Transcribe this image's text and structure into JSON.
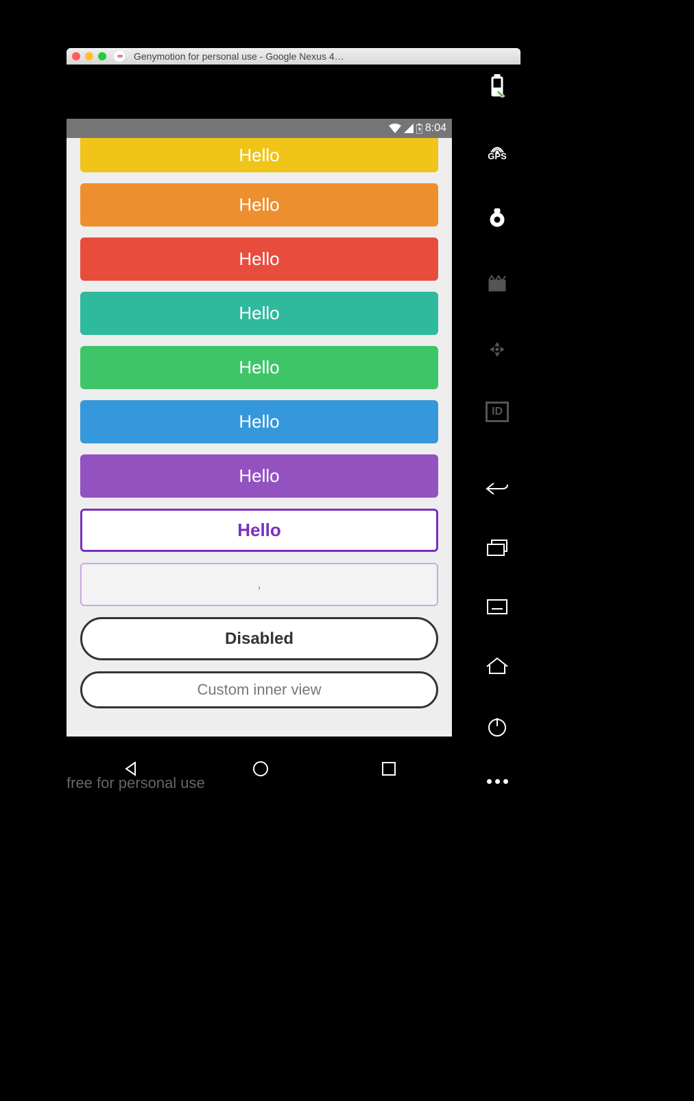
{
  "window": {
    "title": "Genymotion for personal use - Google Nexus 4…"
  },
  "statusbar": {
    "time": "8:04"
  },
  "buttons": [
    {
      "label": "Hello",
      "color": "#F0C419"
    },
    {
      "label": "Hello",
      "color": "#EE8F2F"
    },
    {
      "label": "Hello",
      "color": "#E84C3D"
    },
    {
      "label": "Hello",
      "color": "#2FBA9E"
    },
    {
      "label": "Hello",
      "color": "#3EC567"
    },
    {
      "label": "Hello",
      "color": "#3598DB"
    },
    {
      "label": "Hello",
      "color": "#9451C0"
    }
  ],
  "outline": {
    "label": "Hello"
  },
  "outline_light": {
    "label": ","
  },
  "disabled": {
    "label": "Disabled"
  },
  "custom": {
    "label": "Custom inner view"
  },
  "footer": {
    "label": "free for personal use"
  },
  "right_tools": {
    "gps": "GPS",
    "id": "ID"
  }
}
